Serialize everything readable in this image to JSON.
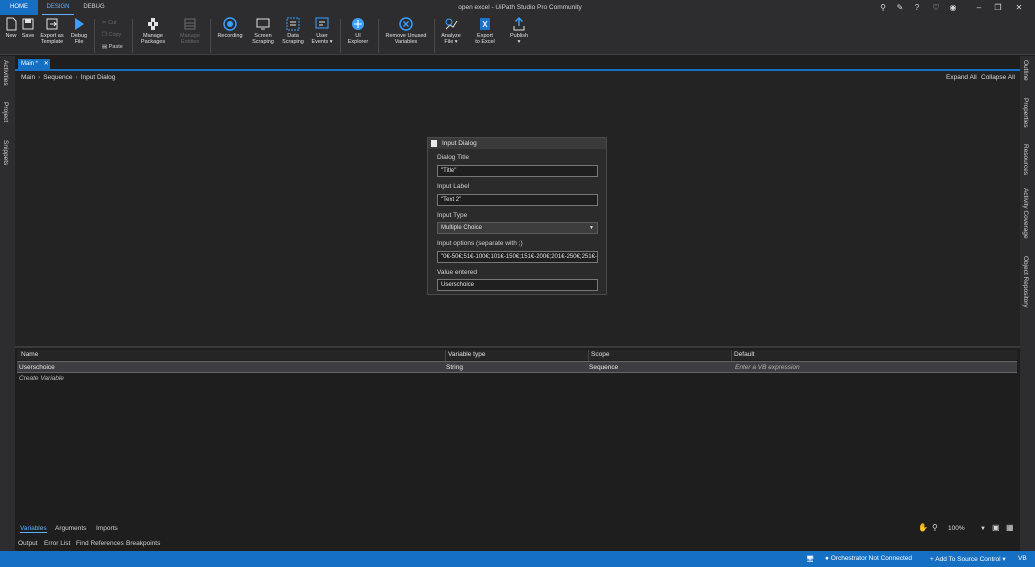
{
  "ribbon_tabs": [
    "HOME",
    "DESIGN",
    "DEBUG"
  ],
  "window_title": "open excel - UiPath Studio Pro Community",
  "ribbon": {
    "new": "New",
    "save": "Save",
    "export_template": [
      "Export as",
      "Template"
    ],
    "debug_file": [
      "Debug",
      "File"
    ],
    "cut": "Cut",
    "copy": "Copy",
    "paste": "Paste",
    "manage_packages": [
      "Manage",
      "Packages"
    ],
    "manage_entities": [
      "Manage",
      "Entities"
    ],
    "recording": "Recording",
    "screen_scraping": [
      "Screen",
      "Scraping"
    ],
    "data_scraping": [
      "Data",
      "Scraping"
    ],
    "user_events": [
      "User",
      "Events"
    ],
    "ui_explorer": [
      "UI",
      "Explorer"
    ],
    "remove_unused_variables": [
      "Remove Unused",
      "Variables"
    ],
    "analyze_file": [
      "Analyze",
      "File"
    ],
    "export_excel": [
      "Export",
      "to Excel"
    ],
    "publish": "Publish"
  },
  "left_panels": [
    "Activities",
    "Project",
    "Snippets"
  ],
  "right_panels": [
    "Outline",
    "Properties",
    "Resources",
    "Activity Coverage",
    "Object Repository"
  ],
  "doc_tab": "Main *",
  "breadcrumb": [
    "Main",
    "Sequence",
    "Input Dialog"
  ],
  "expand_all": "Expand All",
  "collapse_all": "Collapse All",
  "activity": {
    "title": "Input Dialog",
    "dialog_title_label": "Dialog Title",
    "dialog_title_value": "\"Title\"",
    "input_label_label": "Input Label",
    "input_label_value": "\"Text 2\"",
    "input_type_label": "Input Type",
    "input_type_value": "Multiple Choice",
    "input_options_label": "Input options (separate with ;)",
    "input_options_value": "\"0€-50€;51€-100€;101€-150€;151€-200€;201€-250€;251€-",
    "value_entered_label": "Value entered",
    "value_entered_value": "Userschoice"
  },
  "variables": {
    "headers": [
      "Name",
      "Variable type",
      "Scope",
      "Default"
    ],
    "row": {
      "name": "Userschoice",
      "type": "String",
      "scope": "Sequence",
      "default": "Enter a VB expression"
    },
    "create": "Create Variable"
  },
  "bottom_tabs": [
    "Variables",
    "Arguments",
    "Imports"
  ],
  "zoom": "100%",
  "output_tabs": [
    "Output",
    "Error List",
    "Find References",
    "Breakpoints"
  ],
  "status": {
    "orchestrator": "Orchestrator Not Connected",
    "source_control": "Add To Source Control",
    "language": "VB"
  },
  "accent": "#1570c4"
}
